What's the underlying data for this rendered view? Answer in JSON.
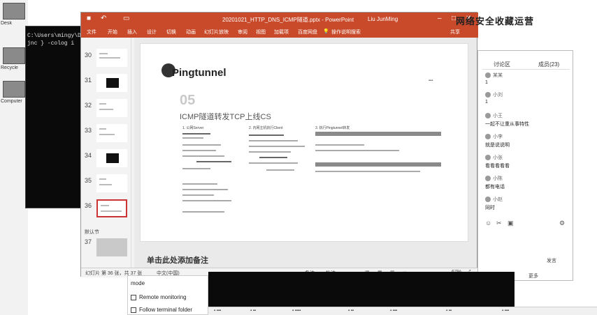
{
  "desktop": {
    "icons": [
      {
        "label": "Desk"
      },
      {
        "label": "Recycle"
      },
      {
        "label": "Computer"
      }
    ]
  },
  "terminal": {
    "lines": [
      "C:\\Users\\mingy\\Des",
      "jnc } -colog i"
    ]
  },
  "ppt": {
    "title": "20201021_HTTP_DNS_ICMP隧道.pptx - PowerPoint",
    "user": "Liu JunMing",
    "ribbon_tabs": [
      "文件",
      "开始",
      "插入",
      "设计",
      "切换",
      "动画",
      "幻灯片放映",
      "审阅",
      "视图",
      "加载项",
      "百度网盘",
      "操作说明搜索",
      "共享"
    ],
    "thumb_numbers": [
      "30",
      "31",
      "32",
      "33",
      "34",
      "35",
      "36",
      "37"
    ],
    "thumb_section": "默认节",
    "slide": {
      "title": "Pingtunnel",
      "number": "05",
      "subtitle": "ICMP隧道转发TCP上线CS",
      "steps": [
        "1. 公网Server",
        "2. 内网主机执行Client",
        "3. 执行Pingtunnel转发"
      ]
    },
    "notes_placeholder": "单击此处添加备注",
    "status": {
      "slide_info": "幻灯片 第 36 张，共 37 张",
      "lang": "中文(中国)",
      "notes": "备注",
      "comments": "批注",
      "zoom": "67%"
    }
  },
  "chat": {
    "tabs": [
      "讨论区",
      "成员(23)"
    ],
    "messages": [
      {
        "user": "某某",
        "text": "1"
      },
      {
        "user": "小刘",
        "text": "1"
      },
      {
        "user": "小王",
        "text": "一起不让重从事特性"
      },
      {
        "user": "小李",
        "text": "就是说说明"
      },
      {
        "user": "小张",
        "text": "看看看看看"
      },
      {
        "user": "小陈",
        "text": "都有电话"
      },
      {
        "user": "小赵",
        "text": "同时"
      }
    ],
    "footer_left": "发言",
    "footer_right": "更多"
  },
  "watermark": "网络安全收藏运营",
  "lower_panel": {
    "items": [
      "mode",
      "Remote monitoring",
      "Follow terminal folder"
    ]
  }
}
